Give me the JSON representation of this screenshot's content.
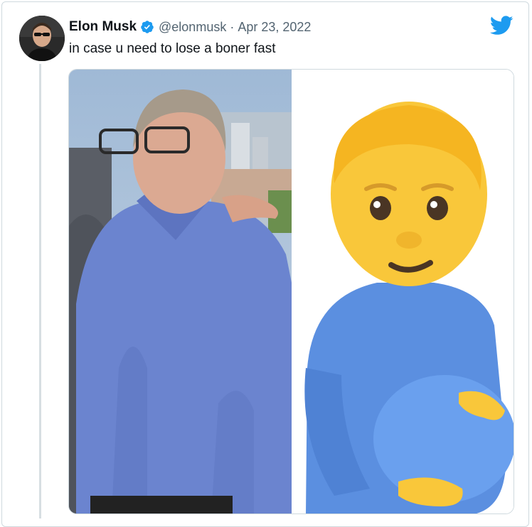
{
  "tweet": {
    "author_name": "Elon Musk",
    "handle": "@elonmusk",
    "separator": "·",
    "date": "Apr 23, 2022",
    "text": "in case u need to lose a boner fast"
  },
  "icons": {
    "verified": "verified-badge-icon",
    "brand": "twitter-bird-icon"
  },
  "colors": {
    "brand_blue": "#1d9bf0",
    "name_text": "#0f1419",
    "meta_text": "#536471",
    "border": "#cfd9de"
  },
  "media": {
    "left_image": "photo of smiling man in blue polo shirt",
    "right_image": "pregnant man emoji in blue shirt"
  }
}
